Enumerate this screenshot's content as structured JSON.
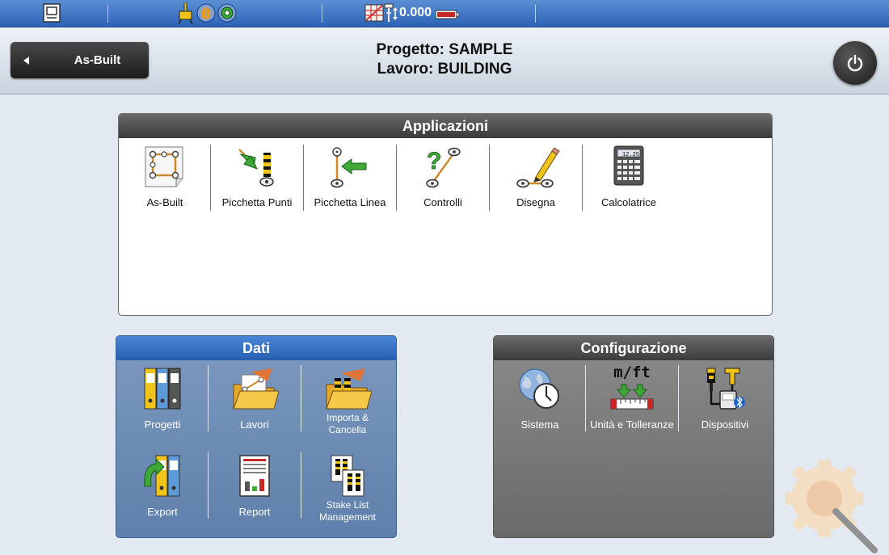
{
  "status_bar": {
    "icons": [
      "device-icon",
      "rover-icon",
      "hand-icon",
      "prism-icon",
      "grid-icon",
      "pole-icon",
      "vertical-arrows-icon",
      "battery-icon"
    ],
    "height_readout": "0.000"
  },
  "header": {
    "back_label": "As-Built",
    "project_line": "Progetto: SAMPLE",
    "job_line": "Lavoro: BUILDING"
  },
  "applicazioni": {
    "title": "Applicazioni",
    "items": [
      {
        "label": "As-Built",
        "icon": "as-built-icon"
      },
      {
        "label": "Picchetta Punti",
        "icon": "stake-points-icon"
      },
      {
        "label": "Picchetta Linea",
        "icon": "stake-line-icon"
      },
      {
        "label": "Controlli",
        "icon": "checks-icon"
      },
      {
        "label": "Disegna",
        "icon": "draw-icon"
      },
      {
        "label": "Calcolatrice",
        "icon": "calculator-icon"
      }
    ]
  },
  "dati": {
    "title": "Dati",
    "items": [
      {
        "label": "Progetti",
        "icon": "projects-icon"
      },
      {
        "label": "Lavori",
        "icon": "jobs-icon"
      },
      {
        "label": "Importa &",
        "label2": "Cancella",
        "icon": "import-delete-icon"
      },
      {
        "label": "Export",
        "icon": "export-icon"
      },
      {
        "label": "Report",
        "icon": "report-icon"
      },
      {
        "label": "Stake List",
        "label2": "Management",
        "icon": "stake-list-icon"
      }
    ]
  },
  "configurazione": {
    "title": "Configurazione",
    "items": [
      {
        "label": "Sistema",
        "icon": "system-icon"
      },
      {
        "label": "Unità e Tolleranze",
        "icon": "units-tolerances-icon",
        "badge": "m/ft"
      },
      {
        "label": "Dispositivi",
        "icon": "devices-icon"
      }
    ]
  },
  "colors": {
    "status_bar": "#2c62b4",
    "dati_header": "#245fb0",
    "dark_header": "#3a3a3a",
    "background": "#e2e9f1"
  }
}
